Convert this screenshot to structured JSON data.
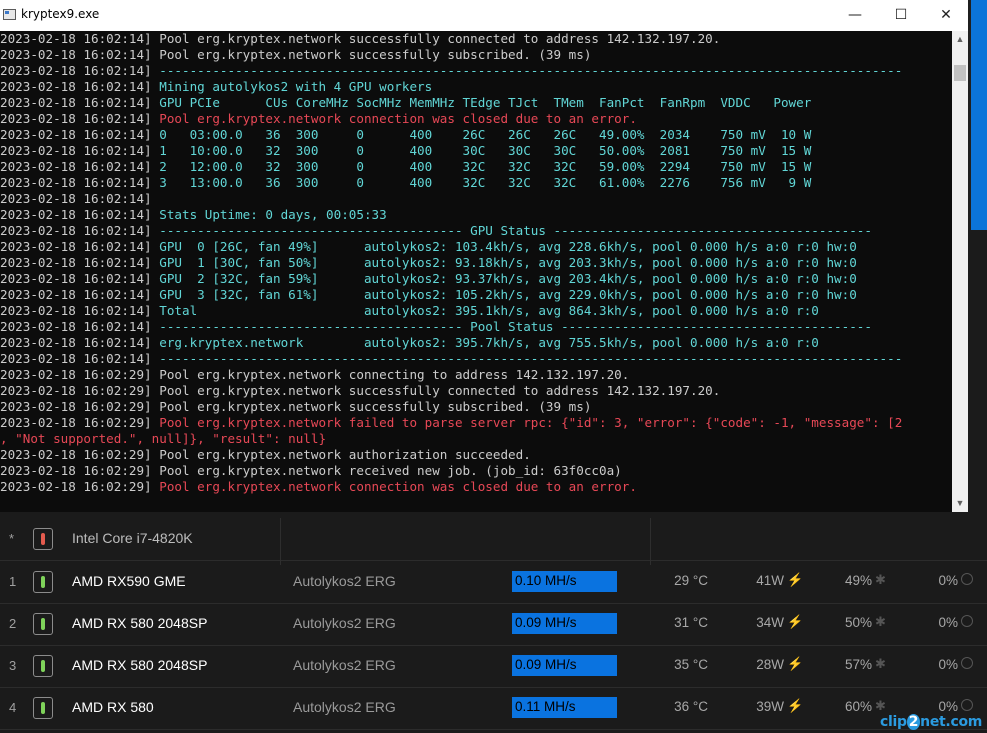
{
  "window": {
    "title": "kryptex9.exe",
    "minimize": "—",
    "maximize": "☐",
    "close": "✕"
  },
  "console": {
    "lines": [
      {
        "ts": "2023-02-18 16:02:14]",
        "text": "Pool erg.kryptex.network successfully connected to address 142.132.197.20.",
        "color": "white"
      },
      {
        "ts": "2023-02-18 16:02:14]",
        "text": "Pool erg.kryptex.network successfully subscribed. (39 ms)",
        "color": "white"
      },
      {
        "ts": "2023-02-18 16:02:14]",
        "text": "--------------------------------------------------------------------------------------------------",
        "color": "cyan"
      },
      {
        "ts": "2023-02-18 16:02:14]",
        "text": "Mining autolykos2 with 4 GPU workers",
        "color": "cyan"
      },
      {
        "ts": "2023-02-18 16:02:14]",
        "text": "GPU PCIe      CUs CoreMHz SocMHz MemMHz TEdge TJct  TMem  FanPct  FanRpm  VDDC   Power",
        "color": "cyan"
      },
      {
        "ts": "2023-02-18 16:02:14]",
        "text": "Pool erg.kryptex.network connection was closed due to an error.",
        "color": "red"
      },
      {
        "ts": "2023-02-18 16:02:14]",
        "text": "0   03:00.0   36  300     0      400    26C   26C   26C   49.00%  2034    750 mV  10 W",
        "color": "cyan"
      },
      {
        "ts": "2023-02-18 16:02:14]",
        "text": "1   10:00.0   32  300     0      400    30C   30C   30C   50.00%  2081    750 mV  15 W",
        "color": "cyan"
      },
      {
        "ts": "2023-02-18 16:02:14]",
        "text": "2   12:00.0   32  300     0      400    32C   32C   32C   59.00%  2294    750 mV  15 W",
        "color": "cyan"
      },
      {
        "ts": "2023-02-18 16:02:14]",
        "text": "3   13:00.0   36  300     0      400    32C   32C   32C   61.00%  2276    756 mV   9 W",
        "color": "cyan"
      },
      {
        "ts": "2023-02-18 16:02:14]",
        "text": "",
        "color": "white"
      },
      {
        "ts": "2023-02-18 16:02:14]",
        "text": "Stats Uptime: 0 days, 00:05:33",
        "color": "cyan"
      },
      {
        "ts": "2023-02-18 16:02:14]",
        "text": "---------------------------------------- GPU Status ------------------------------------------",
        "color": "cyan"
      },
      {
        "ts": "2023-02-18 16:02:14]",
        "text": "GPU  0 [26C, fan 49%]      autolykos2: 103.4kh/s, avg 228.6kh/s, pool 0.000 h/s a:0 r:0 hw:0",
        "color": "cyan"
      },
      {
        "ts": "2023-02-18 16:02:14]",
        "text": "GPU  1 [30C, fan 50%]      autolykos2: 93.18kh/s, avg 203.3kh/s, pool 0.000 h/s a:0 r:0 hw:0",
        "color": "cyan"
      },
      {
        "ts": "2023-02-18 16:02:14]",
        "text": "GPU  2 [32C, fan 59%]      autolykos2: 93.37kh/s, avg 203.4kh/s, pool 0.000 h/s a:0 r:0 hw:0",
        "color": "cyan"
      },
      {
        "ts": "2023-02-18 16:02:14]",
        "text": "GPU  3 [32C, fan 61%]      autolykos2: 105.2kh/s, avg 229.0kh/s, pool 0.000 h/s a:0 r:0 hw:0",
        "color": "cyan"
      },
      {
        "ts": "2023-02-18 16:02:14]",
        "text": "Total                      autolykos2: 395.1kh/s, avg 864.3kh/s, pool 0.000 h/s a:0 r:0",
        "color": "cyan"
      },
      {
        "ts": "2023-02-18 16:02:14]",
        "text": "---------------------------------------- Pool Status -----------------------------------------",
        "color": "cyan"
      },
      {
        "ts": "2023-02-18 16:02:14]",
        "text": "erg.kryptex.network        autolykos2: 395.7kh/s, avg 755.5kh/s, pool 0.000 h/s a:0 r:0",
        "color": "cyan"
      },
      {
        "ts": "2023-02-18 16:02:14]",
        "text": "--------------------------------------------------------------------------------------------------",
        "color": "cyan"
      },
      {
        "ts": "2023-02-18 16:02:29]",
        "text": "Pool erg.kryptex.network connecting to address 142.132.197.20.",
        "color": "white"
      },
      {
        "ts": "2023-02-18 16:02:29]",
        "text": "Pool erg.kryptex.network successfully connected to address 142.132.197.20.",
        "color": "white"
      },
      {
        "ts": "2023-02-18 16:02:29]",
        "text": "Pool erg.kryptex.network successfully subscribed. (39 ms)",
        "color": "white"
      },
      {
        "ts": "2023-02-18 16:02:29]",
        "text": "Pool erg.kryptex.network failed to parse server rpc: {\"id\": 3, \"error\": {\"code\": -1, \"message\": [2",
        "color": "red"
      },
      {
        "ts": "",
        "text": ", \"Not supported.\", null]}, \"result\": null}",
        "color": "red"
      },
      {
        "ts": "2023-02-18 16:02:29]",
        "text": "Pool erg.kryptex.network authorization succeeded.",
        "color": "white"
      },
      {
        "ts": "2023-02-18 16:02:29]",
        "text": "Pool erg.kryptex.network received new job. (job_id: 63f0cc0a)",
        "color": "white"
      },
      {
        "ts": "2023-02-18 16:02:29]",
        "text": "Pool erg.kryptex.network connection was closed due to an error.",
        "color": "red"
      }
    ]
  },
  "scrollbar": {
    "up": "▲",
    "down": "▼"
  },
  "devices": {
    "cpu": {
      "index": "*",
      "name": "Intel Core i7-4820K"
    },
    "gpus": [
      {
        "index": "1",
        "name": "AMD RX590 GME",
        "algorithm": "Autolykos2 ERG",
        "hashrate": "0.10 MH/s",
        "hash_fill": 1.0,
        "temp": "29 °C",
        "power": "41W",
        "fan": "49%",
        "util": "0%"
      },
      {
        "index": "2",
        "name": "AMD RX 580 2048SP",
        "algorithm": "Autolykos2 ERG",
        "hashrate": "0.09 MH/s",
        "hash_fill": 1.0,
        "temp": "31 °C",
        "power": "34W",
        "fan": "50%",
        "util": "0%"
      },
      {
        "index": "3",
        "name": "AMD RX 580 2048SP",
        "algorithm": "Autolykos2 ERG",
        "hashrate": "0.09 MH/s",
        "hash_fill": 1.0,
        "temp": "35 °C",
        "power": "28W",
        "fan": "57%",
        "util": "0%"
      },
      {
        "index": "4",
        "name": "AMD RX 580",
        "algorithm": "Autolykos2 ERG",
        "hashrate": "0.11 MH/s",
        "hash_fill": 1.0,
        "temp": "36 °C",
        "power": "39W",
        "fan": "60%",
        "util": "0%"
      }
    ]
  },
  "icons": {
    "power": "⚡",
    "fan": "✱"
  },
  "colors": {
    "console_bg": "#0c0c0c",
    "cyan": "#61d6d6",
    "red": "#e74856",
    "hash_bar": "#0a73e0"
  },
  "watermark": {
    "prefix": "clip",
    "mid": "2",
    "suffix": "net.com"
  }
}
